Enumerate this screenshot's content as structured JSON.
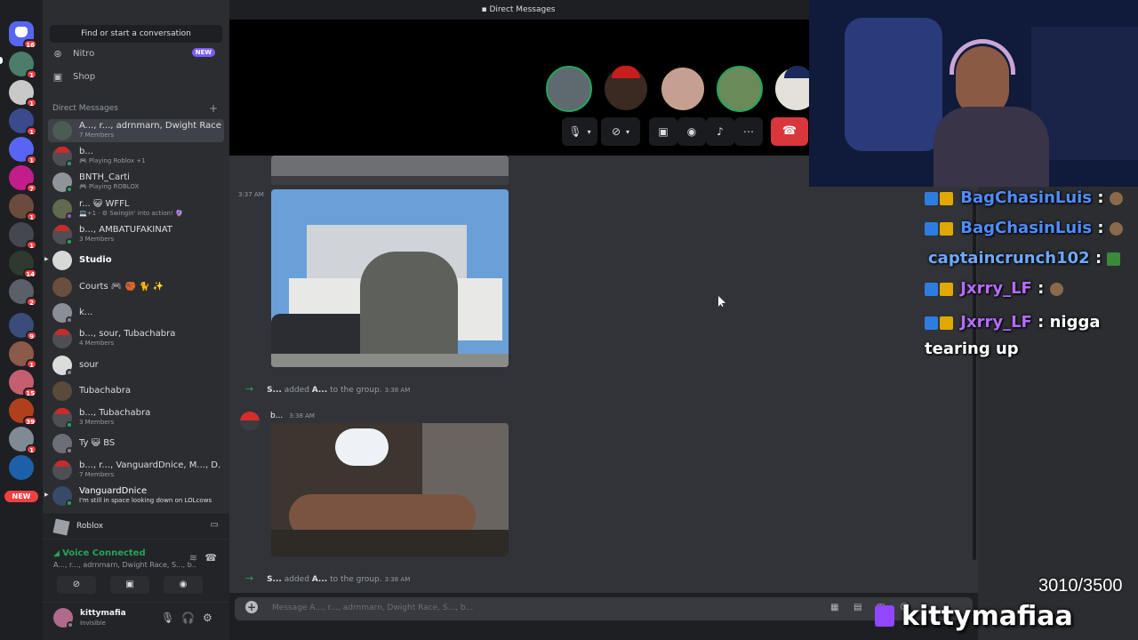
{
  "window": {
    "title": "Direct Messages"
  },
  "rail": {
    "badges": [
      "16",
      "1",
      "1",
      "1",
      "1",
      "7",
      "1",
      "1",
      "14",
      "2",
      "9",
      "1",
      "15",
      "39",
      "1"
    ],
    "new_label": "NEW"
  },
  "sidebar": {
    "search_label": "Find or start a conversation",
    "nav": [
      {
        "label": "Nitro",
        "icon": "nitro-icon",
        "tag": "NEW"
      },
      {
        "label": "Shop",
        "icon": "shop-icon"
      }
    ],
    "dm_header": "Direct Messages",
    "dms": [
      {
        "name": "A..., r..., adrnmarn, Dwight Race...",
        "sub": "7 Members",
        "active": true
      },
      {
        "name": "b...",
        "sub": "🎮 Playing Roblox +1"
      },
      {
        "name": "BNTH_Carti",
        "sub": "🎮 Playing ROBLOX"
      },
      {
        "name": "r... 😺 WFFL",
        "sub": "💻+1 · ⚙ Swingin' into action! 🔮"
      },
      {
        "name": "b..., AMBATUFAKINAT",
        "sub": "3 Members"
      },
      {
        "name": "Studio",
        "sub": ""
      },
      {
        "name": "Courts 🎮 🏀 🐈 ✨",
        "sub": ""
      },
      {
        "name": "k...",
        "sub": ""
      },
      {
        "name": "b..., sour, Tubachabra",
        "sub": "4 Members"
      },
      {
        "name": "sour",
        "sub": ""
      },
      {
        "name": "Tubachabra",
        "sub": ""
      },
      {
        "name": "b..., Tubachabra",
        "sub": "3 Members"
      },
      {
        "name": "Ty 😺 BS",
        "sub": ""
      },
      {
        "name": "b..., r..., VanguardDnice, M..., D...",
        "sub": "7 Members"
      },
      {
        "name": "VanguardDnice",
        "sub": "I'm still in space looking down on LOLcows"
      }
    ],
    "activity": {
      "label": "Roblox"
    },
    "voice": {
      "status": "Voice Connected",
      "members": "A..., r..., adrnmarn, Dwight Race, S..., b..."
    },
    "user": {
      "name": "kittymafia",
      "status": "Invisible"
    }
  },
  "call": {
    "participants": [
      "participant-1",
      "participant-2",
      "participant-3",
      "participant-4",
      "participant-5"
    ]
  },
  "messages": {
    "times": [
      "3:37 AM"
    ],
    "system1": {
      "actor": "S...",
      "text": "added",
      "target": "A...",
      "tail": "to the group.",
      "time": "3:38 AM"
    },
    "message": {
      "author": "b...",
      "time": "3:38 AM"
    },
    "system2": {
      "actor": "S...",
      "text": "added",
      "target": "A...",
      "tail": "to the group.",
      "time": "3:38 AM"
    },
    "composer_placeholder": "Message A..., r..., adrnmarn, Dwight Race, S..., b..."
  },
  "stream_chat": [
    {
      "user": "BagChasinLuis",
      "color": "#4f8cff",
      "text": ""
    },
    {
      "user": "BagChasinLuis",
      "color": "#4f8cff",
      "text": ""
    },
    {
      "user": "captaincrunch102",
      "color": "#6fa8ff",
      "text": ""
    },
    {
      "user": "Jxrry_LF",
      "color": "#b46cff",
      "text": ""
    },
    {
      "user": "Jxrry_LF",
      "color": "#b46cff",
      "text": "nigga tearing up"
    }
  ],
  "overlay": {
    "counter": "3010/3500",
    "brand": "kittymafiaa"
  }
}
